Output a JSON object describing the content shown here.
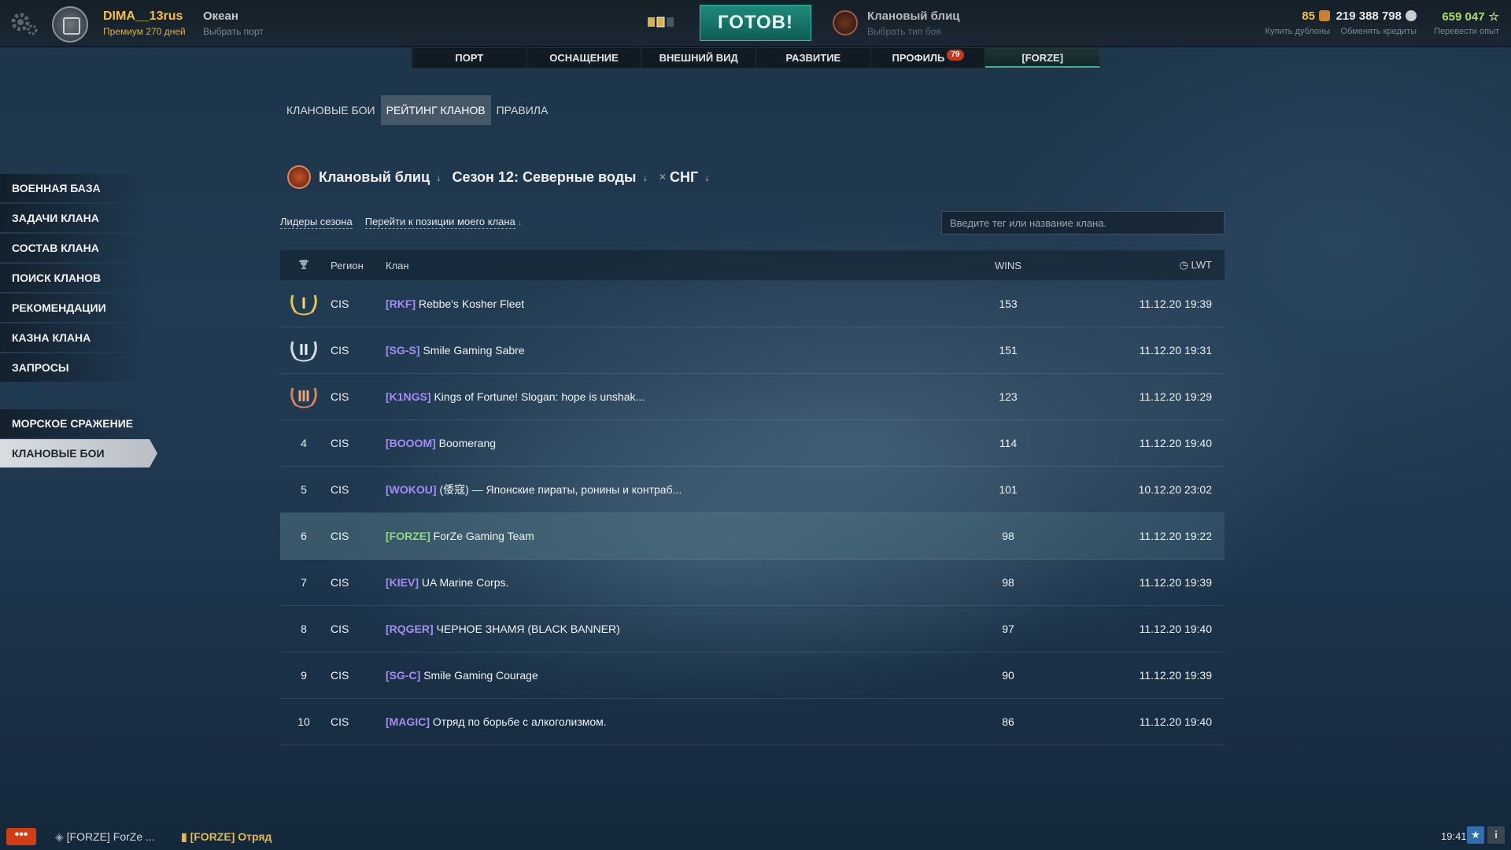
{
  "header": {
    "username": "DIMA__13rus",
    "premium": "Премиум 270 дней",
    "port_name": "Океан",
    "port_sub": "Выбрать порт",
    "ready_label": "ГОТОВ!",
    "mode_name": "Клановый блиц",
    "mode_sub": "Выбрать тип боя",
    "doubloons": "85",
    "doubloons_sub": "Купить дублоны",
    "credits": "219 388 798",
    "credits_sub": "Обменять кредиты",
    "xp": "659 047",
    "xp_sub": "Перевести опыт"
  },
  "main_tabs": [
    {
      "label": "ПОРТ"
    },
    {
      "label": "ОСНАЩЕНИЕ"
    },
    {
      "label": "ВНЕШНИЙ ВИД"
    },
    {
      "label": "РАЗВИТИЕ"
    },
    {
      "label": "ПРОФИЛЬ",
      "badge": "79"
    },
    {
      "label": "[FORZE]"
    }
  ],
  "sub_tabs": [
    {
      "label": "КЛАНОВЫЕ БОИ"
    },
    {
      "label": "РЕЙТИНГ КЛАНОВ"
    },
    {
      "label": "ПРАВИЛА"
    }
  ],
  "sidebar": {
    "items": [
      {
        "label": "ВОЕННАЯ БАЗА"
      },
      {
        "label": "ЗАДАЧИ КЛАНА"
      },
      {
        "label": "СОСТАВ КЛАНА"
      },
      {
        "label": "ПОИСК КЛАНОВ"
      },
      {
        "label": "РЕКОМЕНДАЦИИ"
      },
      {
        "label": "КАЗНА КЛАНА"
      },
      {
        "label": "ЗАПРОСЫ"
      },
      {
        "label": "МОРСКОЕ СРАЖЕНИЕ"
      },
      {
        "label": "КЛАНОВЫЕ БОИ"
      }
    ]
  },
  "season": {
    "mode": "Клановый блиц",
    "season": "Сезон 12: Северные воды",
    "region": "СНГ"
  },
  "links": {
    "leaders": "Лидеры сезона",
    "goto_my_clan": "Перейти к позиции моего клана"
  },
  "search": {
    "placeholder": "Введите тег или название клана."
  },
  "table": {
    "headers": {
      "rank": "",
      "region": "Регион",
      "clan": "Клан",
      "wins": "WINS",
      "lwt": "LWT"
    },
    "rows": [
      {
        "rank": "1",
        "region": "CIS",
        "tag": "[RKF]",
        "name": "Rebbe's Kosher Fleet",
        "wins": "153",
        "lwt": "11.12.20 19:39"
      },
      {
        "rank": "2",
        "region": "CIS",
        "tag": "[SG-S]",
        "name": "Smile Gaming Sabre",
        "wins": "151",
        "lwt": "11.12.20 19:31"
      },
      {
        "rank": "3",
        "region": "CIS",
        "tag": "[K1NGS]",
        "name": "Kings of Fortune! Slogan: hope is unshak...",
        "wins": "123",
        "lwt": "11.12.20 19:29"
      },
      {
        "rank": "4",
        "region": "CIS",
        "tag": "[BOOOM]",
        "name": "Boomerang",
        "wins": "114",
        "lwt": "11.12.20 19:40"
      },
      {
        "rank": "5",
        "region": "CIS",
        "tag": "[WOKOU]",
        "name": "(倭寇) — Японские пираты, ронины и контраб...",
        "wins": "101",
        "lwt": "10.12.20 23:02"
      },
      {
        "rank": "6",
        "region": "CIS",
        "tag": "[FORZE]",
        "name": "ForZe Gaming Team",
        "wins": "98",
        "lwt": "11.12.20 19:22"
      },
      {
        "rank": "7",
        "region": "CIS",
        "tag": "[KIEV]",
        "name": "UA Marine Corps.",
        "wins": "98",
        "lwt": "11.12.20 19:39"
      },
      {
        "rank": "8",
        "region": "CIS",
        "tag": "[RQGER]",
        "name": "ЧЕРНОЕ ЗНАМЯ (BLACK BANNER)",
        "wins": "97",
        "lwt": "11.12.20 19:40"
      },
      {
        "rank": "9",
        "region": "CIS",
        "tag": "[SG-C]",
        "name": "Smile Gaming Courage",
        "wins": "90",
        "lwt": "11.12.20 19:39"
      },
      {
        "rank": "10",
        "region": "CIS",
        "tag": "[MAGIC]",
        "name": "Отряд по борьбе с алкоголизмом.",
        "wins": "86",
        "lwt": "11.12.20 19:40"
      }
    ]
  },
  "bottom": {
    "chat_label": "•••",
    "clan_chat": "[FORZE] ForZe ...",
    "division": "[FORZE] Отряд",
    "time": "19:41"
  },
  "colors": {
    "accent_teal": "#39b39a",
    "gold": "#f4c244",
    "tag_purple": "#a78cf3",
    "tag_own": "#8edb7c",
    "chat_red": "#d23d12"
  }
}
